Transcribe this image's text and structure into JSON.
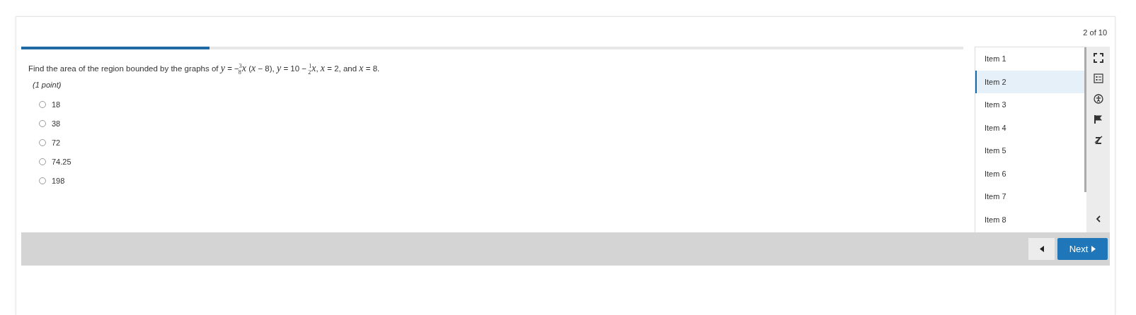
{
  "counter": "2 of 10",
  "progress": {
    "level": 0.2
  },
  "question": {
    "text": "Find the area of the region bounded by the graphs of *y* = −$^{3}$$_{8}$*x* (*x* − 8), *y* = 10 − $^{1}$$_{2}$*x*, *x* = 2, and *x* = 8.",
    "points": "(1 point)"
  },
  "options": [
    {
      "label": "18",
      "selected": false
    },
    {
      "label": "38",
      "selected": false
    },
    {
      "label": "72",
      "selected": false
    },
    {
      "label": "74.25",
      "selected": false
    },
    {
      "label": "198",
      "selected": false
    }
  ],
  "items": [
    {
      "label": "Item 1",
      "selected": false
    },
    {
      "label": "Item 2",
      "selected": true
    },
    {
      "label": "Item 3",
      "selected": false
    },
    {
      "label": "Item 4",
      "selected": false
    },
    {
      "label": "Item 5",
      "selected": false
    },
    {
      "label": "Item 6",
      "selected": false
    },
    {
      "label": "Item 7",
      "selected": false
    },
    {
      "label": "Item 8",
      "selected": false
    }
  ],
  "tools": [
    {
      "kind": "fullscreen"
    },
    {
      "kind": "list"
    },
    {
      "kind": "accessibility"
    },
    {
      "kind": "flag"
    },
    {
      "kind": "eliminator"
    },
    {
      "kind": "collapse"
    }
  ],
  "navigation": {
    "next": "Next"
  }
}
